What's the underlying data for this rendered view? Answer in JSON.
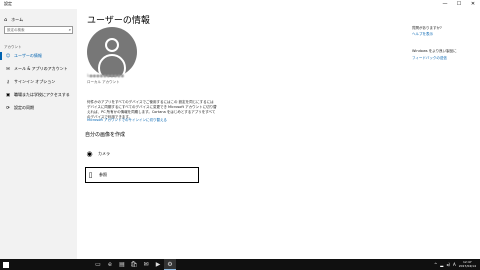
{
  "window": {
    "title": "設定",
    "minimize": "—",
    "maximize": "☐",
    "close": "✕"
  },
  "sidebar": {
    "home_label": "ホーム",
    "search_placeholder": "設定の検索",
    "section_label": "アカウント",
    "items": [
      {
        "label": "ユーザーの情報",
        "icon": "user-icon",
        "glyph": "☺",
        "active": true
      },
      {
        "label": "メール & アプリのアカウント",
        "icon": "mail-icon",
        "glyph": "✉",
        "active": false
      },
      {
        "label": "サインイン オプション",
        "icon": "key-icon",
        "glyph": "⚷",
        "active": false
      },
      {
        "label": "職場または学校にアクセスする",
        "icon": "briefcase-icon",
        "glyph": "▣",
        "active": false
      },
      {
        "label": "設定の同期",
        "icon": "sync-icon",
        "glyph": "⟳",
        "active": false
      }
    ]
  },
  "main": {
    "heading": "ユーザーの情報",
    "username": "k●●●●●●●●●●",
    "account_type": "ローカル アカウント",
    "description": "何件かのアプリをすべてのデバイスでご使用するにはこの 設定を同じにするにはデバイスに同期するにすべてのデバイスに変更でき Microsoft アカウントに切り替えれば、PC 所有かの情報を同期します。Cortana をはじめとするアプリをすべてのデバイスで利用できます。",
    "ms_link": "Microsoft アカウントでのサインインに切り替える",
    "create_heading": "自分の画像を作成",
    "options": [
      {
        "label": "カメラ",
        "icon": "camera-icon",
        "glyph": "◉"
      },
      {
        "label": "参照",
        "icon": "browse-icon",
        "glyph": "▯"
      }
    ]
  },
  "right_panel": {
    "question": "質問がありますか?",
    "help_link": "ヘルプを表示",
    "improve": "Windows をより良い製品に",
    "feedback_link": "フィードバックの送信"
  },
  "taskbar": {
    "apps": [
      "▭",
      "e",
      "▤",
      "🛍",
      "✉",
      "▶",
      "⚙"
    ],
    "tray_up": "^",
    "net": "▂",
    "vol": "◂)",
    "ime": "A",
    "time": "12:47",
    "date": "2017/04/14"
  }
}
